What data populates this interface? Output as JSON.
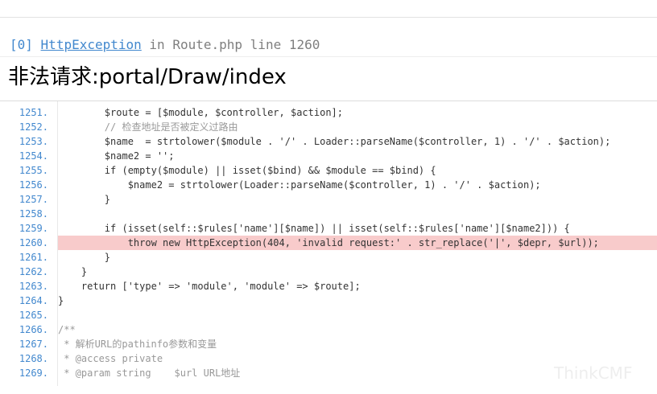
{
  "exception": {
    "code": "[0]",
    "class_name": "HttpException",
    "in_label": "in",
    "file": "Route.php",
    "line_label": "line",
    "line": "1260"
  },
  "message": "非法请求:portal/Draw/index",
  "source": {
    "highlight_line": "1260.",
    "lines": [
      {
        "num": "1251.",
        "code": "        $route = [$module, $controller, $action];"
      },
      {
        "num": "1252.",
        "code": "        // 检查地址是否被定义过路由"
      },
      {
        "num": "1253.",
        "code": "        $name  = strtolower($module . '/' . Loader::parseName($controller, 1) . '/' . $action);"
      },
      {
        "num": "1254.",
        "code": "        $name2 = '';"
      },
      {
        "num": "1255.",
        "code": "        if (empty($module) || isset($bind) && $module == $bind) {"
      },
      {
        "num": "1256.",
        "code": "            $name2 = strtolower(Loader::parseName($controller, 1) . '/' . $action);"
      },
      {
        "num": "1257.",
        "code": "        }"
      },
      {
        "num": "1258.",
        "code": ""
      },
      {
        "num": "1259.",
        "code": "        if (isset(self::$rules['name'][$name]) || isset(self::$rules['name'][$name2])) {"
      },
      {
        "num": "1260.",
        "code": "            throw new HttpException(404, 'invalid request:' . str_replace('|', $depr, $url));"
      },
      {
        "num": "1261.",
        "code": "        }"
      },
      {
        "num": "1262.",
        "code": "    }"
      },
      {
        "num": "1263.",
        "code": "    return ['type' => 'module', 'module' => $route];"
      },
      {
        "num": "1264.",
        "code": "}"
      },
      {
        "num": "1265.",
        "code": ""
      },
      {
        "num": "1266.",
        "code": "/**"
      },
      {
        "num": "1267.",
        "code": " * 解析URL的pathinfo参数和变量"
      },
      {
        "num": "1268.",
        "code": " * @access private"
      },
      {
        "num": "1269.",
        "code": " * @param string    $url URL地址"
      }
    ]
  },
  "watermark": "ThinkCMF"
}
